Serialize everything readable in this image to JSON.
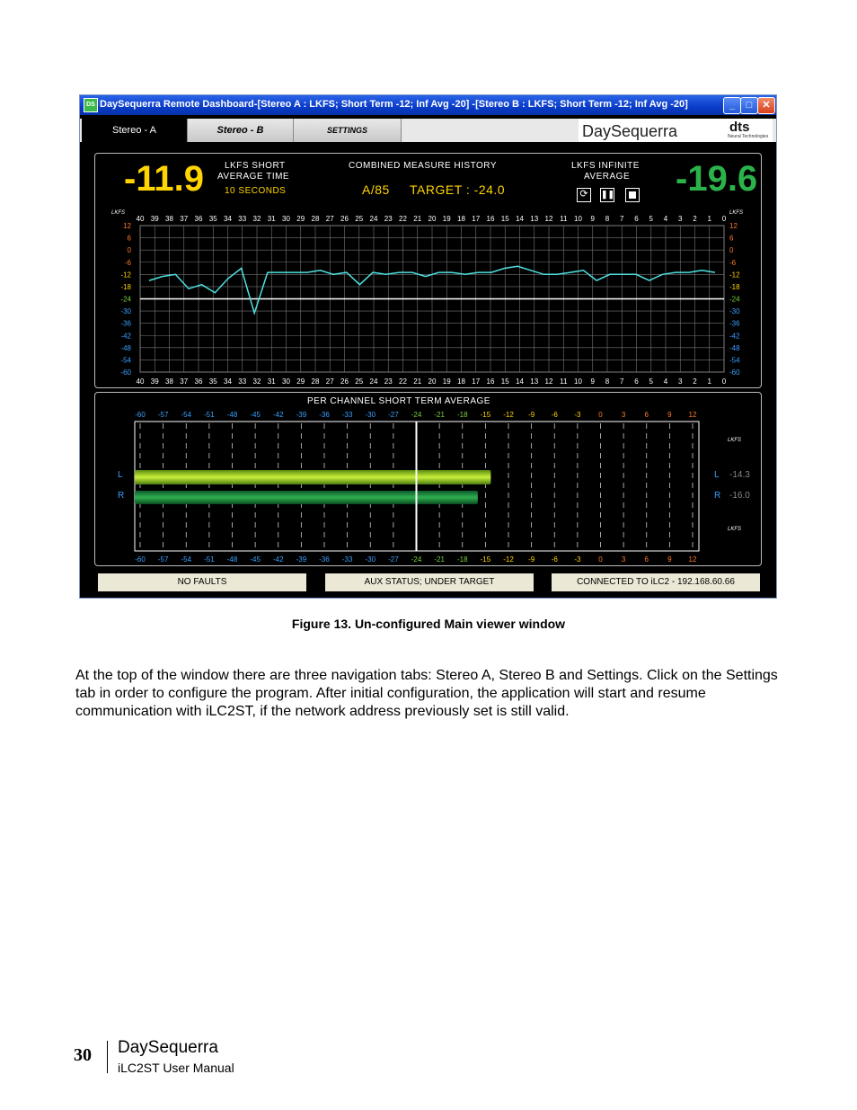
{
  "window": {
    "title": "DaySequerra Remote Dashboard-[Stereo A : LKFS; Short Term -12; Inf Avg -20]   -[Stereo B : LKFS; Short Term -12; Inf Avg -20]",
    "app_icon": "DS",
    "minimize": "_",
    "maximize": "□",
    "close": "✕"
  },
  "tabs": [
    {
      "label": "Stereo - A",
      "active": true
    },
    {
      "label": "Stereo - B",
      "active": false
    },
    {
      "label": "SETTINGS",
      "active": false
    }
  ],
  "brand": {
    "name": "DaySequerra",
    "partner": "dts",
    "partner_sub": "Neural Technologies"
  },
  "meters": {
    "short_value": "-11.9",
    "short_label_1": "LKFS SHORT",
    "short_label_2": "AVERAGE TIME",
    "short_time": "10 SECONDS",
    "history_title": "COMBINED MEASURE HISTORY",
    "standard": "A/85",
    "target": "TARGET : -24.0",
    "inf_label_1": "LKFS INFINITE",
    "inf_label_2": "AVERAGE",
    "inf_value": "-19.6",
    "colors": {
      "short": "#ffd400",
      "inf": "#2bb34a",
      "line": "#4fe0e0"
    }
  },
  "history_chart": {
    "unit": "LKFS",
    "x_ticks": [
      "40",
      "39",
      "38",
      "37",
      "36",
      "35",
      "34",
      "33",
      "32",
      "31",
      "30",
      "29",
      "28",
      "27",
      "26",
      "25",
      "24",
      "23",
      "22",
      "21",
      "20",
      "19",
      "18",
      "17",
      "16",
      "15",
      "14",
      "13",
      "12",
      "11",
      "10",
      "9",
      "8",
      "7",
      "6",
      "5",
      "4",
      "3",
      "2",
      "1",
      "0"
    ],
    "y_ticks": [
      "12",
      "6",
      "0",
      "-6",
      "-12",
      "-18",
      "-24",
      "-30",
      "-36",
      "-42",
      "-48",
      "-54",
      "-60"
    ],
    "target_line": -24,
    "series": [
      -15,
      -13,
      -12,
      -19,
      -17,
      -21,
      -14,
      -9,
      -31,
      -11,
      -11,
      -11,
      -11,
      -10,
      -12,
      -11,
      -17,
      -11,
      -12,
      -11,
      -11,
      -13,
      -11,
      -11,
      -12,
      -11,
      -11,
      -9,
      -8,
      -10,
      -12,
      -12,
      -11,
      -10,
      -15,
      -12,
      -12,
      -12,
      -15,
      -12,
      -11,
      -11,
      -10,
      -11
    ]
  },
  "channel_panel": {
    "title": "PER CHANNEL SHORT TERM AVERAGE",
    "scale": [
      "-60",
      "-57",
      "-54",
      "-51",
      "-48",
      "-45",
      "-42",
      "-39",
      "-36",
      "-33",
      "-30",
      "-27",
      "-24",
      "-21",
      "-18",
      "-15",
      "-12",
      "-9",
      "-6",
      "-3",
      "0",
      "3",
      "6",
      "9",
      "12"
    ],
    "unit": "LKFS",
    "channels": [
      {
        "label": "L",
        "value": -14.3,
        "display": "-14.3"
      },
      {
        "label": "R",
        "value": -16.0,
        "display": "-16.0"
      }
    ],
    "scale_colors": {
      "low": "#3aa0ff",
      "mid": "#7ad03a",
      "high": "#ffd400",
      "over": "#ff7a2a"
    }
  },
  "status_bar": {
    "faults": "NO FAULTS",
    "aux": "AUX STATUS; UNDER TARGET",
    "connection": "CONNECTED TO iLC2 - 192.168.60.66"
  },
  "document": {
    "caption": "Figure 13.  Un-configured Main viewer window",
    "paragraph": "At the top of the window there are three navigation tabs: Stereo A, Stereo B and Settings. Click on the Settings tab in order to configure the program. After initial configuration, the application will start and resume communication with iLC2ST, if the network address previously set is still valid.",
    "page_number": "30",
    "footer_brand": "DaySequerra",
    "footer_manual": "iLC2ST User Manual"
  }
}
